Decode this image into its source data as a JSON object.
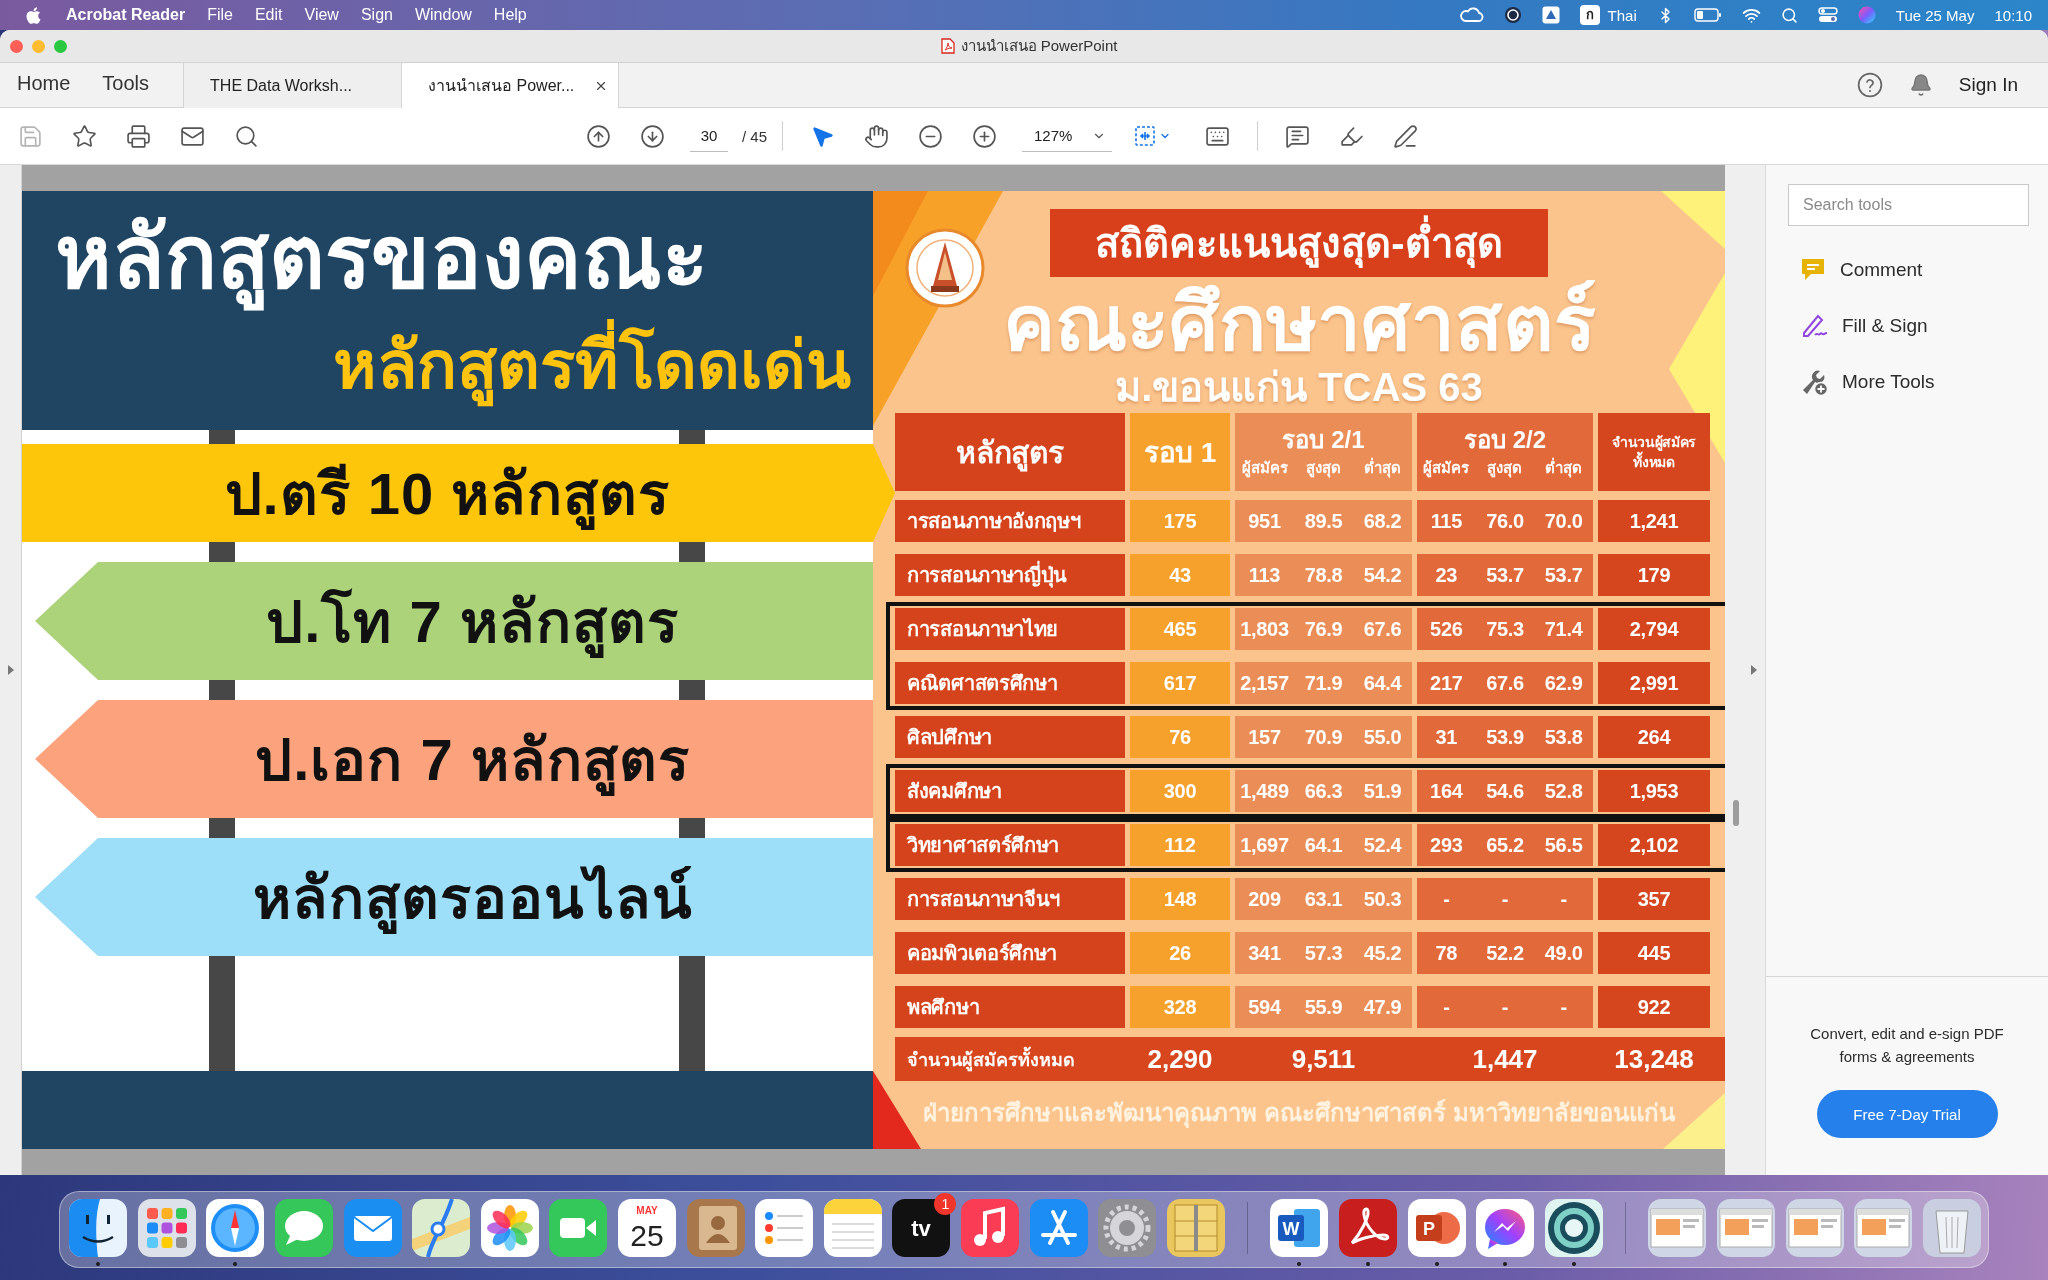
{
  "menu_bar": {
    "app_name": "Acrobat Reader",
    "menus": [
      "File",
      "Edit",
      "View",
      "Sign",
      "Window",
      "Help"
    ],
    "input_source": {
      "glyph": "ก",
      "label": "Thai"
    },
    "date": "Tue 25 May",
    "time": "10:10"
  },
  "window": {
    "title": "งานนำเสนอ PowerPoint"
  },
  "nav_tabs": [
    {
      "label": "Home",
      "selected": false
    },
    {
      "label": "Tools",
      "selected": false
    }
  ],
  "doc_tabs": [
    {
      "label": "THE Data Worksh...",
      "selected": false
    },
    {
      "label": "งานนำเสนอ Power...",
      "selected": true
    }
  ],
  "account": {
    "sign_in": "Sign In"
  },
  "toolbar": {
    "save_disabled": true,
    "page": {
      "current": "30",
      "separator": "/",
      "total": "45"
    },
    "tools": [
      {
        "kind": "select",
        "selected": true
      },
      {
        "kind": "hand",
        "selected": false
      }
    ],
    "zoom": "127%"
  },
  "slide": {
    "heading": "หลักสูตรของคณะ",
    "subheading": "หลักสูตรที่โดดเด่น",
    "signs": [
      {
        "text": "ป.ตรี 10 หลักสูตร",
        "kind": "right-arrow",
        "color": "#fdc60a"
      },
      {
        "text": "ป.โท 7 หลักสูตร",
        "kind": "left-arrow",
        "color": "#acd27a"
      },
      {
        "text": "ป.เอก 7 หลักสูตร",
        "kind": "left-arrow",
        "color": "#fca37e"
      },
      {
        "text": "หลักสูตรออนไลน์",
        "kind": "left-arrow",
        "color": "#9ddff8"
      }
    ],
    "infographic": {
      "banner": "สถิติคะแนนสูงสุด-ต่ำสุด",
      "title": "คณะศึกษาศาสตร์",
      "subtitle": "ม.ขอนแก่น TCAS 63",
      "table": {
        "header": {
          "course": "หลักสูตร",
          "round_1": "รอบ 1",
          "round_2_1": {
            "title": "รอบ 2/1",
            "columns": [
              "ผู้สมัคร",
              "สูงสุด",
              "ต่ำสุด"
            ]
          },
          "round_2_2": {
            "title": "รอบ 2/2",
            "columns": [
              "ผู้สมัคร",
              "สูงสุด",
              "ต่ำสุด"
            ]
          },
          "total": "จำนวนผู้สมัคร ทั้งหมด"
        },
        "row_groups": [
          {
            "boxed": false,
            "rows": [
              {
                "course": "ารสอนภาษาอังกฤษฯ",
                "round_1": "175",
                "round_2_1": [
                  "951",
                  "89.5",
                  "68.2"
                ],
                "round_2_2": [
                  "115",
                  "76.0",
                  "70.0"
                ],
                "total": "1,241"
              },
              {
                "course": "การสอนภาษาญี่ปุ่น",
                "round_1": "43",
                "round_2_1": [
                  "113",
                  "78.8",
                  "54.2"
                ],
                "round_2_2": [
                  "23",
                  "53.7",
                  "53.7"
                ],
                "total": "179"
              }
            ]
          },
          {
            "boxed": true,
            "rows": [
              {
                "course": "การสอนภาษาไทย",
                "round_1": "465",
                "round_2_1": [
                  "1,803",
                  "76.9",
                  "67.6"
                ],
                "round_2_2": [
                  "526",
                  "75.3",
                  "71.4"
                ],
                "total": "2,794"
              },
              {
                "course": "คณิตศาสตรศึกษา",
                "round_1": "617",
                "round_2_1": [
                  "2,157",
                  "71.9",
                  "64.4"
                ],
                "round_2_2": [
                  "217",
                  "67.6",
                  "62.9"
                ],
                "total": "2,991"
              }
            ]
          },
          {
            "boxed": false,
            "rows": [
              {
                "course": "ศิลปศึกษา",
                "round_1": "76",
                "round_2_1": [
                  "157",
                  "70.9",
                  "55.0"
                ],
                "round_2_2": [
                  "31",
                  "53.9",
                  "53.8"
                ],
                "total": "264"
              }
            ]
          },
          {
            "boxed": true,
            "rows": [
              {
                "course": "สังคมศึกษา",
                "round_1": "300",
                "round_2_1": [
                  "1,489",
                  "66.3",
                  "51.9"
                ],
                "round_2_2": [
                  "164",
                  "54.6",
                  "52.8"
                ],
                "total": "1,953"
              }
            ]
          },
          {
            "boxed": true,
            "rows": [
              {
                "course": "วิทยาศาสตร์ศึกษา",
                "round_1": "112",
                "round_2_1": [
                  "1,697",
                  "64.1",
                  "52.4"
                ],
                "round_2_2": [
                  "293",
                  "65.2",
                  "56.5"
                ],
                "total": "2,102"
              }
            ]
          },
          {
            "boxed": false,
            "rows": [
              {
                "course": "การสอนภาษาจีนฯ",
                "round_1": "148",
                "round_2_1": [
                  "209",
                  "63.1",
                  "50.3"
                ],
                "round_2_2": [
                  "-",
                  "-",
                  "-"
                ],
                "total": "357"
              },
              {
                "course": "คอมพิวเตอร์ศึกษา",
                "round_1": "26",
                "round_2_1": [
                  "341",
                  "57.3",
                  "45.2"
                ],
                "round_2_2": [
                  "78",
                  "52.2",
                  "49.0"
                ],
                "total": "445"
              },
              {
                "course": "พลศึกษา",
                "round_1": "328",
                "round_2_1": [
                  "594",
                  "55.9",
                  "47.9"
                ],
                "round_2_2": [
                  "-",
                  "-",
                  "-"
                ],
                "total": "922"
              }
            ]
          }
        ],
        "totals": {
          "label": "จำนวนผู้สมัครทั้งหมด",
          "round_1": "2,290",
          "round_2_1": "9,511",
          "round_2_2": "1,447",
          "total": "13,248"
        }
      },
      "footer": "ฝ่ายการศึกษาและพัฒนาคุณภาพ คณะศึกษาศาสตร์ มหาวิทยาลัยขอนแก่น"
    }
  },
  "tools_panel": {
    "search_placeholder": "Search tools",
    "items": [
      {
        "kind": "comment",
        "label": "Comment"
      },
      {
        "kind": "fill-sign",
        "label": "Fill & Sign"
      },
      {
        "kind": "more-tools",
        "label": "More Tools"
      }
    ],
    "promo": "Convert, edit and e-sign PDF forms & agreements",
    "trial_button": "Free 7-Day Trial"
  },
  "dock": {
    "items": [
      {
        "kind": "finder",
        "running": true
      },
      {
        "kind": "launchpad",
        "running": false
      },
      {
        "kind": "safari",
        "running": true
      },
      {
        "kind": "messages",
        "running": false
      },
      {
        "kind": "mail",
        "running": false
      },
      {
        "kind": "maps",
        "running": false
      },
      {
        "kind": "photos",
        "running": false
      },
      {
        "kind": "facetime",
        "running": false
      },
      {
        "kind": "calendar",
        "month": "MAY",
        "day": "25",
        "running": false
      },
      {
        "kind": "contacts",
        "running": false
      },
      {
        "kind": "reminders",
        "running": false
      },
      {
        "kind": "notes",
        "running": false
      },
      {
        "kind": "tv",
        "glyph": "tv",
        "badge": "1",
        "running": false
      },
      {
        "kind": "music",
        "running": false
      },
      {
        "kind": "appstore",
        "running": false
      },
      {
        "kind": "settings",
        "running": false
      },
      {
        "kind": "archive",
        "running": false
      },
      {
        "kind": "separator"
      },
      {
        "kind": "word",
        "glyph": "W",
        "running": true
      },
      {
        "kind": "acrobat",
        "running": true
      },
      {
        "kind": "powerpoint",
        "glyph": "P",
        "running": true
      },
      {
        "kind": "messenger",
        "running": true
      },
      {
        "kind": "ring",
        "running": true
      },
      {
        "kind": "separator"
      },
      {
        "kind": "window",
        "running": false
      },
      {
        "kind": "window",
        "running": false
      },
      {
        "kind": "window",
        "running": false
      },
      {
        "kind": "window",
        "running": false
      },
      {
        "kind": "trash",
        "running": false
      }
    ]
  }
}
